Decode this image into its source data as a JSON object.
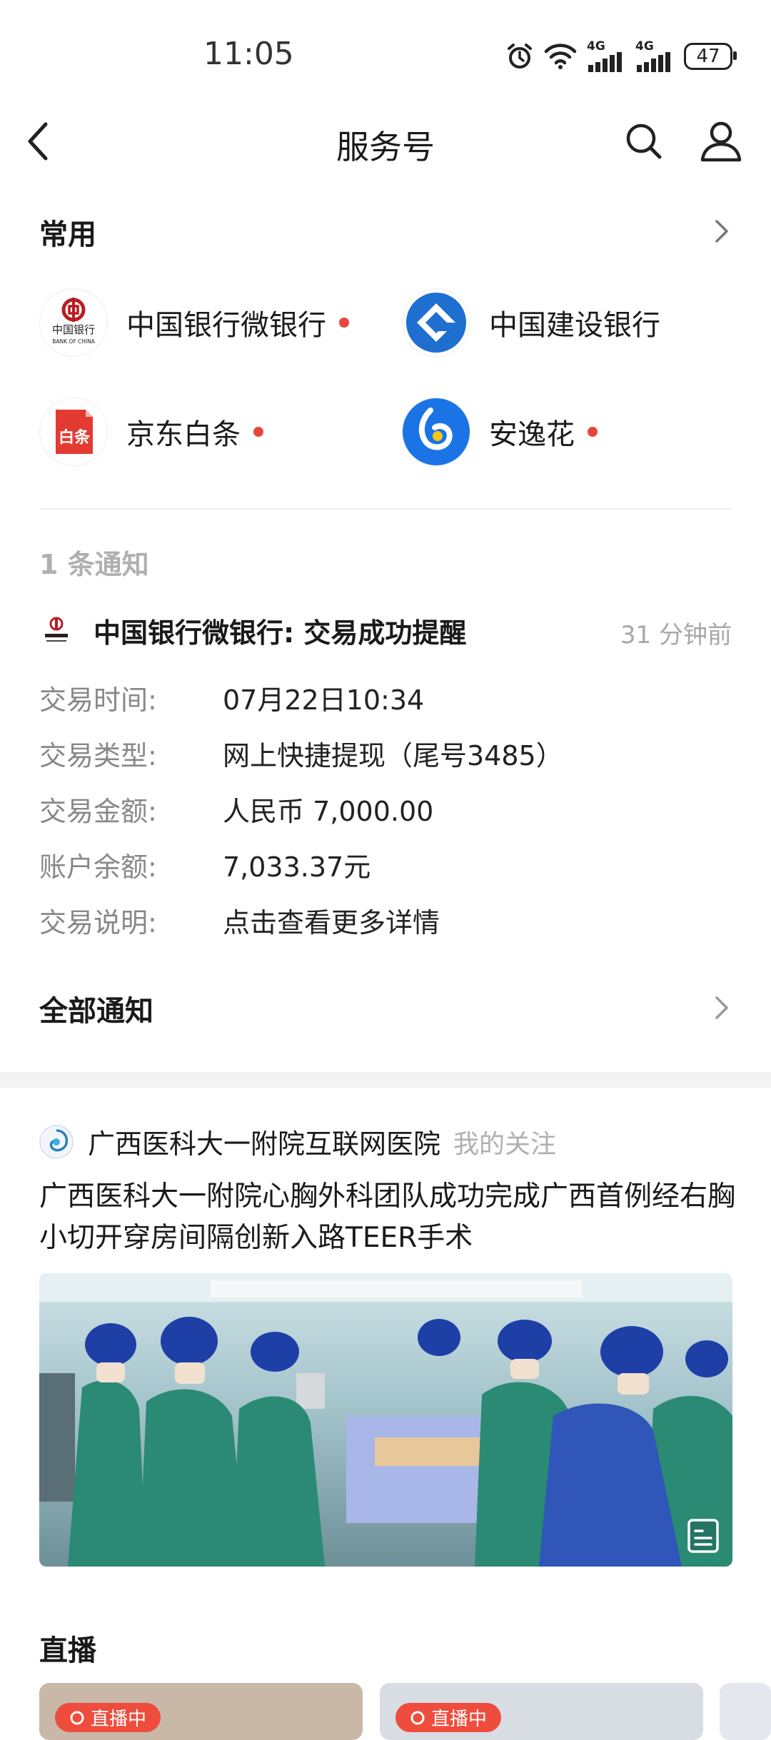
{
  "status_bar": {
    "time": "11:05",
    "network_1": "4G",
    "network_2": "4G",
    "battery": "47"
  },
  "header": {
    "title": "服务号"
  },
  "common": {
    "title": "常用",
    "accounts": [
      {
        "name": "中国银行微银行",
        "unread": true
      },
      {
        "name": "中国建设银行",
        "unread": false
      },
      {
        "name": "京东白条",
        "unread": true,
        "logo_text": "白条"
      },
      {
        "name": "安逸花",
        "unread": true
      }
    ],
    "boc_logo_text": "中国银行",
    "boc_logo_en": "BANK OF CHINA"
  },
  "notifications": {
    "count_label": "1 条通知",
    "sender_title": "中国银行微银行: 交易成功提醒",
    "time_ago": "31 分钟前",
    "details": [
      {
        "label": "交易时间:",
        "value": "07月22日10:34"
      },
      {
        "label": "交易类型:",
        "value": "网上快捷提现（尾号3485）"
      },
      {
        "label": "交易金额:",
        "value": "人民币 7,000.00"
      },
      {
        "label": "账户余额:",
        "value": "7,033.37元"
      },
      {
        "label": "交易说明:",
        "value": "点击查看更多详情"
      }
    ],
    "all_label": "全部通知"
  },
  "feed": {
    "source_name": "广西医科大一附院互联网医院",
    "source_tag": "我的关注",
    "headline": "广西医科大一附院心胸外科团队成功完成广西首例经右胸小切开穿房间隔创新入路TEER手术"
  },
  "live": {
    "title": "直播",
    "badge": "直播中"
  },
  "colors": {
    "unread_dot": "#e8453c",
    "ccb_blue": "#1e6fd0",
    "jd_red": "#e33b32",
    "ayh_blue": "#1a74e6",
    "live_red": "#ee4d3d"
  }
}
